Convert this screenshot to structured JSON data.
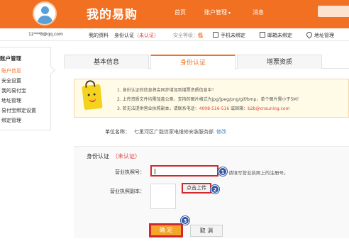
{
  "header": {
    "brand": "我的易购",
    "nav": {
      "home": "首页",
      "account": "账户管理",
      "account_caret": "▾",
      "messages": "消息"
    },
    "colors": {
      "accent": "#f27021"
    }
  },
  "info_bar": {
    "username": "12***8@qq.com",
    "my_info": "我的资料",
    "id_auth": "身份认证",
    "id_auth_status": "（未认证）",
    "security_label": "安全等级：",
    "security_value": "低",
    "bindings": [
      {
        "label": "手机未绑定",
        "icon": "phone-icon"
      },
      {
        "label": "邮箱未绑定",
        "icon": "mail-icon"
      },
      {
        "label": "地址管理",
        "icon": "location-icon"
      }
    ]
  },
  "sidebar": {
    "title": "账户管理",
    "items": [
      {
        "label": "账户信息",
        "active": true
      },
      {
        "label": "安全设置"
      },
      {
        "label": "我的易付宝"
      },
      {
        "label": "地址管理"
      },
      {
        "label": "易付宝绑定设置"
      },
      {
        "label": "绑定管理"
      }
    ]
  },
  "tabs": [
    {
      "label": "基本信息"
    },
    {
      "label": "身份认证",
      "active": true
    },
    {
      "label": "增票资质"
    }
  ],
  "notice": {
    "lines": [
      "1. 身份认证的信息将会同步增加到增票资质信息中！",
      "2. 上传资质文件均需加盖公章，支持的图片格式为jpg/jpeg/png/gif/bmp，单个图片需小于5M！",
      "3. 若无法提供营业执照副本，请联系电话："
    ],
    "phone": "4008-516-516",
    "email_prefix": "或邮箱：",
    "email": "b2b@cnsuning.com"
  },
  "company": {
    "label": "单位名称：",
    "value": "七里河区广能信家电维修安装服务部",
    "modify": "修改"
  },
  "form": {
    "section_title": "身份认证",
    "section_status": "（未认证）",
    "license_label": "营业执照号：",
    "license_value": "",
    "license_hint": "请填写营业执照上的注册号。",
    "copy_label": "营业执照副本：",
    "upload_label": "点击上传",
    "ok_label": "确 定",
    "cancel_label": "取 消"
  },
  "step_markers": [
    "1",
    "2",
    "3"
  ]
}
